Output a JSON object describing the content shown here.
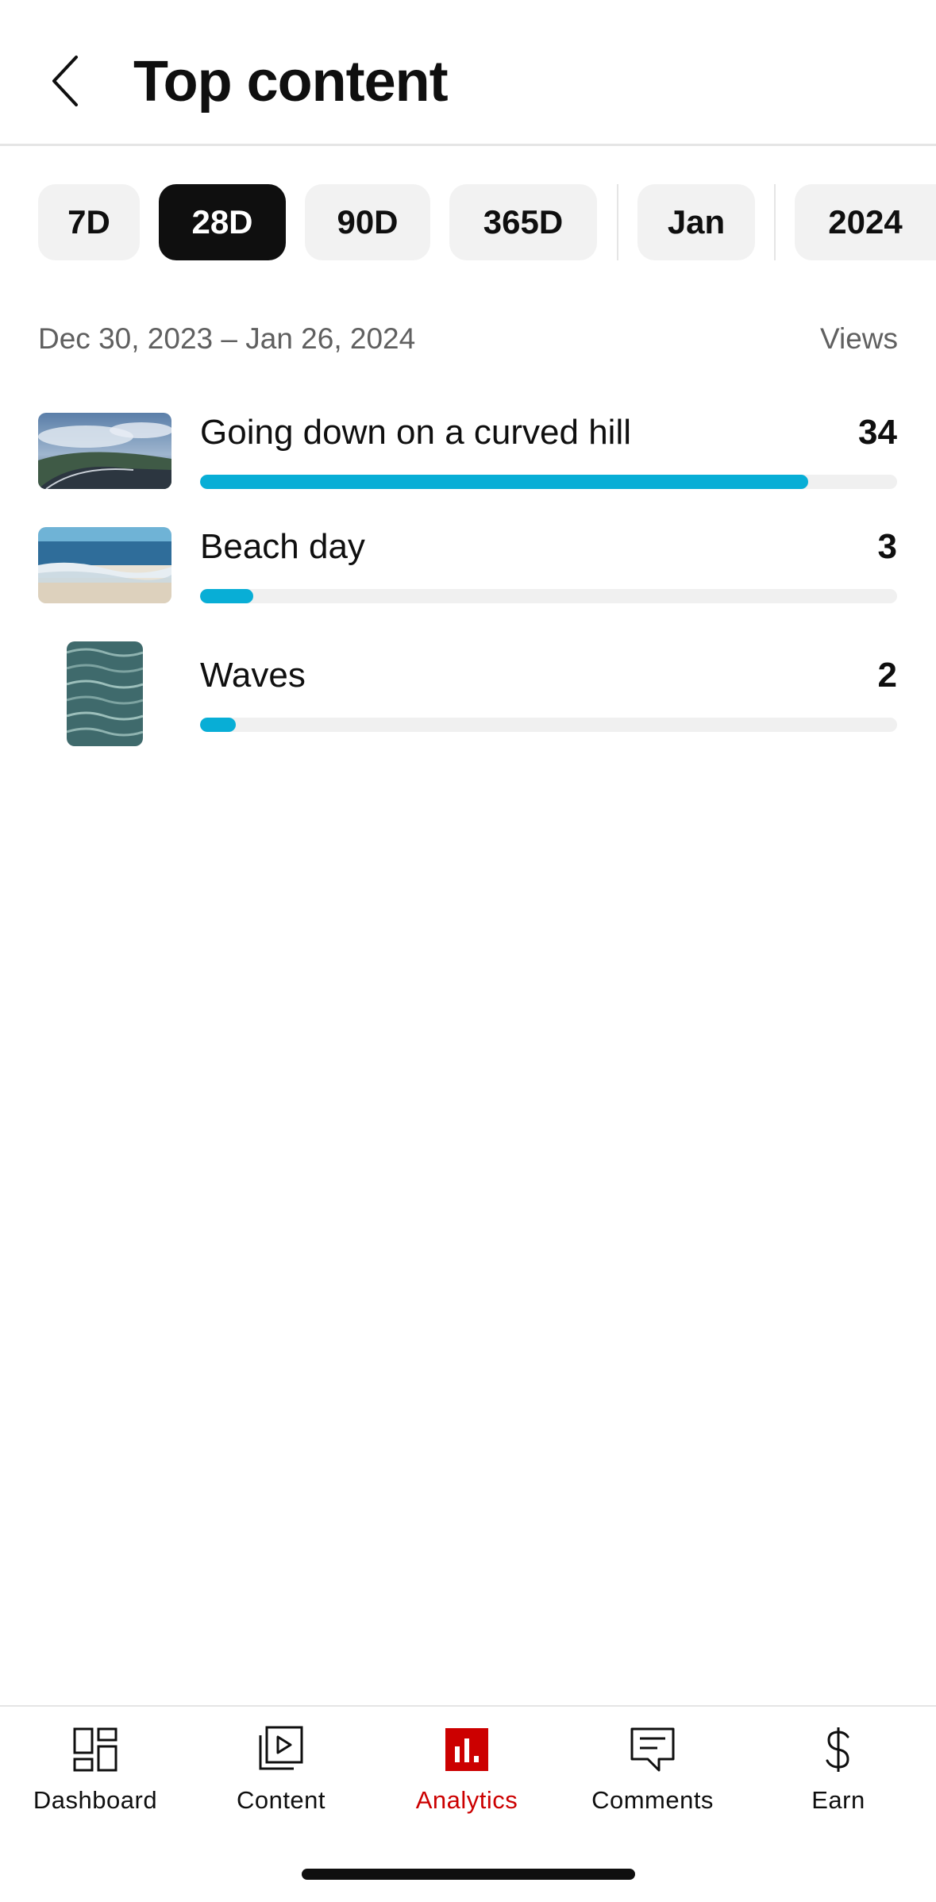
{
  "header": {
    "title": "Top content"
  },
  "chips": [
    {
      "label": "7D",
      "selected": false
    },
    {
      "label": "28D",
      "selected": true
    },
    {
      "label": "90D",
      "selected": false
    },
    {
      "label": "365D",
      "selected": false
    },
    {
      "label": "Jan",
      "selected": false
    },
    {
      "label": "2024",
      "selected": false
    }
  ],
  "range": {
    "dates": "Dec 30, 2023 – Jan 26, 2024",
    "metric": "Views"
  },
  "items": [
    {
      "title": "Going down on a curved hill",
      "views": "34",
      "fraction": 1.0
    },
    {
      "title": "Beach day",
      "views": "3",
      "fraction": 0.088
    },
    {
      "title": "Waves",
      "views": "2",
      "fraction": 0.059
    }
  ],
  "nav": [
    {
      "label": "Dashboard",
      "icon": "dashboard-icon",
      "active": false
    },
    {
      "label": "Content",
      "icon": "content-icon",
      "active": false
    },
    {
      "label": "Analytics",
      "icon": "analytics-icon",
      "active": true
    },
    {
      "label": "Comments",
      "icon": "comments-icon",
      "active": false
    },
    {
      "label": "Earn",
      "icon": "dollar-icon",
      "active": false
    }
  ],
  "colors": {
    "accent_bar": "#08aed6",
    "active_nav": "#cc0000",
    "chip_bg": "#f2f2f2",
    "chip_selected_bg": "#0f0f0f"
  }
}
